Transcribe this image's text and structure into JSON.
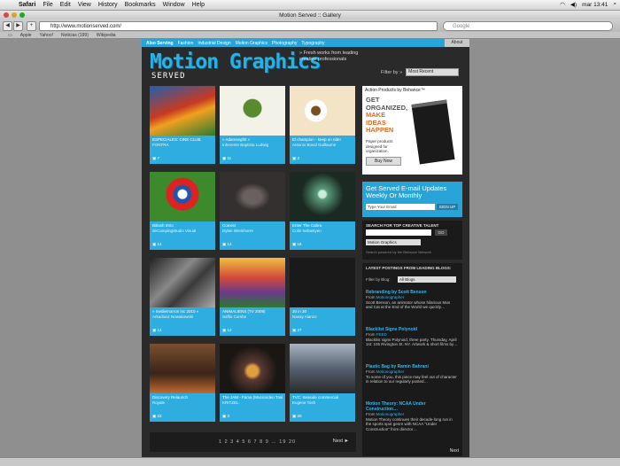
{
  "menubar": {
    "items": [
      "Safari",
      "File",
      "Edit",
      "View",
      "History",
      "Bookmarks",
      "Window",
      "Help"
    ],
    "right": [
      "mar 13:41"
    ]
  },
  "window": {
    "title": "Motion Served :: Gallery"
  },
  "toolbar": {
    "url": "http://www.motionserved.com/",
    "search_placeholder": "Google"
  },
  "bookmarks": [
    "Apple",
    "Yahoo!",
    "Noticias (199)",
    "Wikipedia"
  ],
  "site": {
    "nav": [
      "Also Serving",
      "Fashion",
      "Industrial Design",
      "Motion Graphics",
      "Photography",
      "Typography"
    ],
    "about": "About",
    "logo": "Motion Graphics",
    "served": "SERVED",
    "tagline": "» Fresh works from leading creative professionals",
    "filter_label": "Filter by »",
    "filter_value": "Most Recent",
    "tiles": [
      {
        "title": "ESPECIALES: CINE CLUB",
        "author": "FONTRA",
        "count": "7",
        "thumb": "#b03020"
      },
      {
        "title": "» Adamsegfrit «",
        "author": "Inherente Baptista Ludwig",
        "count": "11",
        "thumb": "#f2f2e8"
      },
      {
        "title": "El champion - keep on ride!",
        "author": "Antonio Brasil Guillaume",
        "count": "3",
        "thumb": "#f3e4c8"
      },
      {
        "title": "Bitlash Intro",
        "author": "deCampingStudio Visual",
        "count": "14",
        "thumb": "#3c8a2c"
      },
      {
        "title": "Coexist",
        "author": "Dylan Wreinhorre",
        "count": "14",
        "thumb": "#353030"
      },
      {
        "title": "Enter The Cabra",
        "author": "Colin Sebastyen",
        "count": "16",
        "thumb": "#2f4a3a"
      },
      {
        "title": "» mediemorron inc 2010 «",
        "author": "Arkadiusz Nowakowski",
        "count": "14",
        "thumb": "#444"
      },
      {
        "title": "ANIMALIENS (TV 2009)",
        "author": "Saffio Combe",
        "count": "12",
        "thumb": "#c75a4a"
      },
      {
        "title": "30 in 30",
        "author": "Nasay Alanzo",
        "count": "27",
        "thumb": "#1a1a1a"
      },
      {
        "title": "Discovery Relaunch",
        "author": "Royale",
        "count": "22",
        "thumb": "#4a3020"
      },
      {
        "title": "The JAM - Fama (Musicvideo Trailer)",
        "author": "KRITZEL",
        "count": "3",
        "thumb": "#352e2a"
      },
      {
        "title": "TVC: Seaside commercial",
        "author": "Eugene Tosh",
        "count": "20",
        "thumb": "#556070"
      }
    ],
    "pager": {
      "pages": "1 2 3 4 5 6 7 8 9 … 19 20",
      "next": "Next ►"
    }
  },
  "sidebar": {
    "ad_header": "Action Products by Behance™",
    "ad_line1": "GET ORGANIZED,",
    "ad_line2": "MAKE IDEAS HAPPEN",
    "ad_small": "Paper products designed for organization.",
    "ad_buy": "Buy Now",
    "email_heading": "Get Served E-mail Updates Weekly Or Monthly",
    "email_placeholder": "Type Your Email",
    "email_button": "SIGN UP",
    "talent_heading": "SEARCH FOR TOP CREATIVE TALENT",
    "talent_go": "GO",
    "talent_select": "Motion Graphics",
    "talent_note": "Search powered by the Behance Network",
    "blogs_heading": "LATEST POSTINGS FROM LEADING BLOGS:",
    "blogs_filter_label": "Filter by Blog:",
    "blogs_filter_value": "All Blogs",
    "posts": [
      {
        "title": "Rebranding by Scott Benson",
        "from": "Motionographer",
        "body": "Scott Benson, an animator whose hilarious Man and Cat at the End of the World we quickly…"
      },
      {
        "title": "Blacklist Signs Polynoid",
        "from": "FEED",
        "body": "Blacklist signs Polynoid, three party. Thursday, April 1st: 105 Rivington St. NY. Artwork & short films by…"
      },
      {
        "title": "Plastic Bag by Ramin Bahrani",
        "from": "Motionographer",
        "body": "To some of you, this piece may feel out of character in relation to our regularly posted…"
      },
      {
        "title": "Motion Theory: NCAA Under Construction…",
        "from": "Motionographer",
        "body": "Motion Theory continues their decade-long run in the sports spot genre with NCAA \"Under Construction\" from director…"
      }
    ],
    "blogs_next": "Next"
  }
}
